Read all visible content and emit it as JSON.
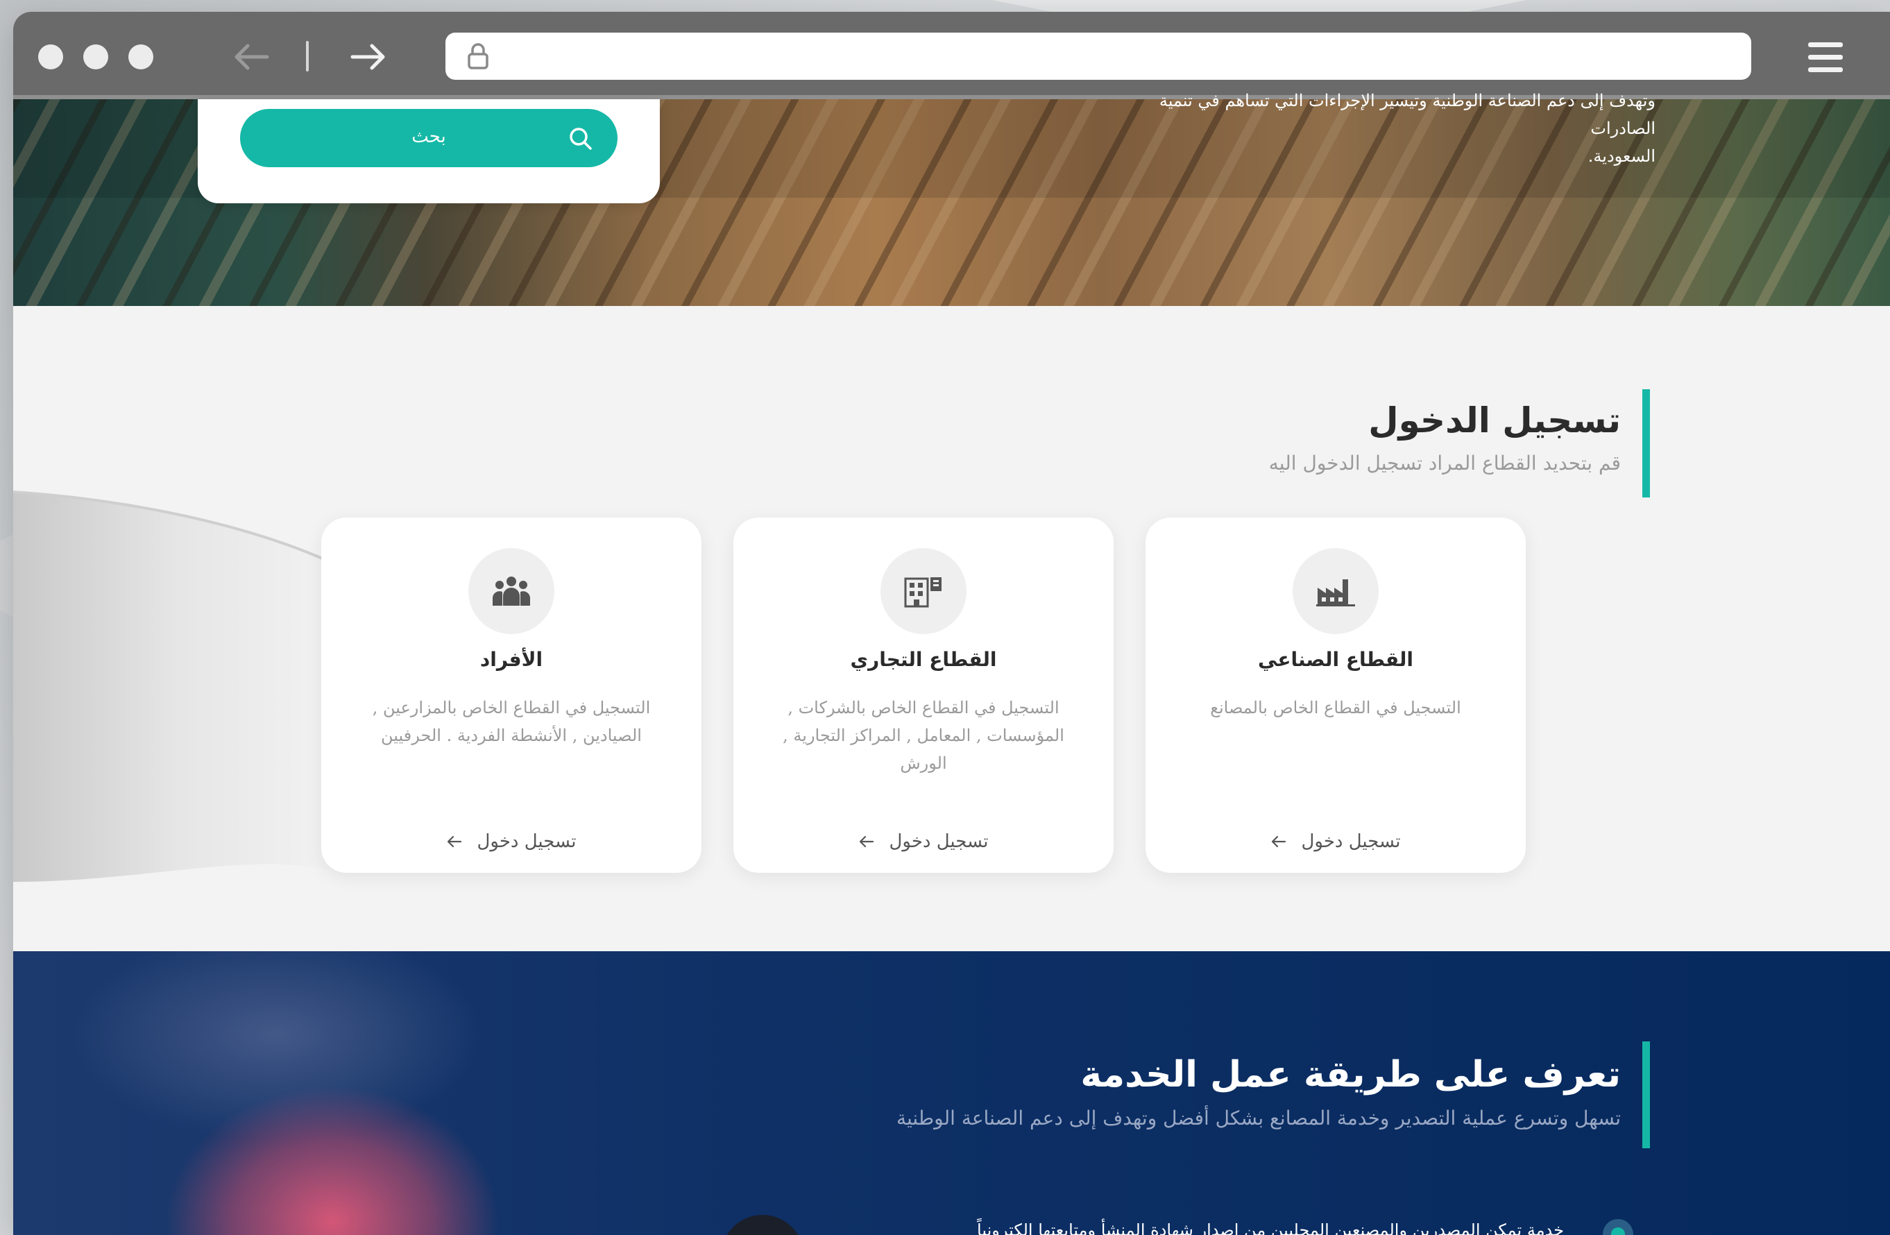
{
  "browser": {
    "url": "",
    "icons": {
      "back": "arrow-left-icon",
      "forward": "arrow-right-icon",
      "lock": "lock-icon",
      "menu": "hamburger-menu-icon"
    }
  },
  "hero": {
    "intro_line1": "وتهدف إلى دعم الصناعة الوطنية وتيسير الإجراءات التي تساهم في تنمية الصادرات",
    "intro_line2": "السعودية.",
    "search_button": "بحث"
  },
  "login": {
    "title": "تسجيل الدخول",
    "subtitle": "قم بتحديد القطاع المراد تسجيل الدخول اليه",
    "cards": [
      {
        "icon": "people-group-icon",
        "title": "الأفراد",
        "description": "التسجيل في القطاع الخاص بالمزارعين , الصيادين , الأنشطة الفردية . الحرفيين",
        "link": "تسجيل دخول"
      },
      {
        "icon": "office-building-icon",
        "title": "القطاع التجاري",
        "description": "التسجيل في القطاع الخاص بالشركات , المؤسسات , المعامل , المراكز التجارية , الورش",
        "link": "تسجيل دخول"
      },
      {
        "icon": "factory-icon",
        "title": "القطاع الصناعي",
        "description": "التسجيل في القطاع الخاص بالمصانع",
        "link": "تسجيل دخول"
      }
    ]
  },
  "service": {
    "title": "تعرف على طريقة عمل الخدمة",
    "subtitle": "تسهل وتسرع عملية التصدير وخدمة المصانع بشكل أفضل وتهدف إلى دعم الصناعة الوطنية",
    "step_text": "خدمة تمكن المصدرين والمصنعين المحليين من إصدار شهادة المنشأ ومتابعتها إلكترونياً"
  },
  "colors": {
    "accent": "#15b8a6",
    "toolbar": "#6a6a6a",
    "service_bg": "#06295d"
  }
}
